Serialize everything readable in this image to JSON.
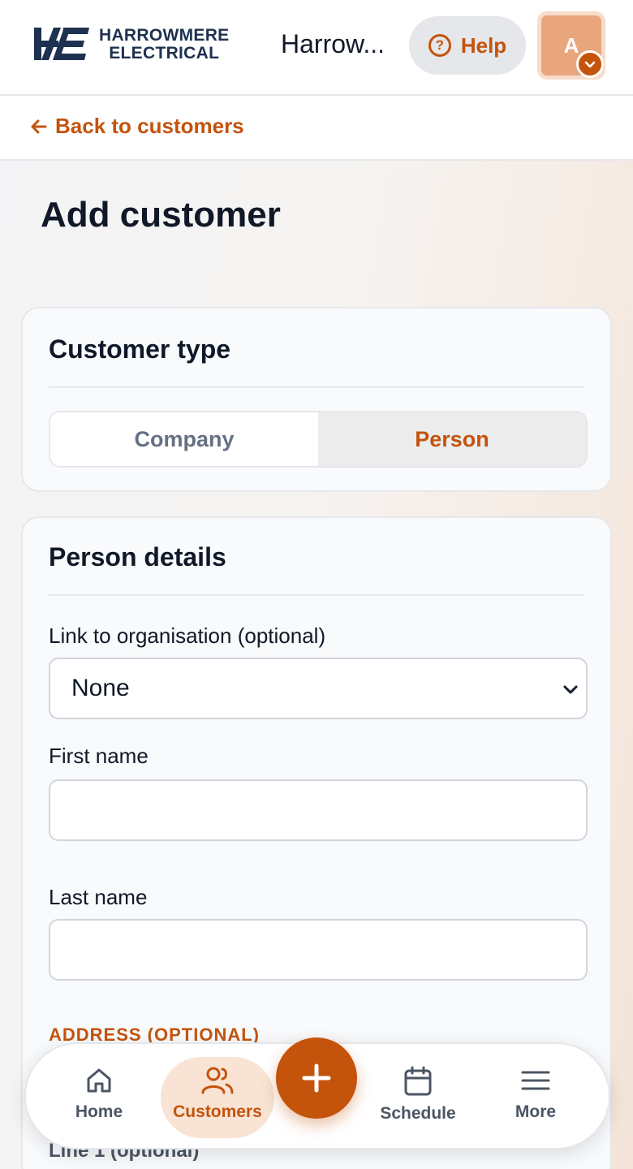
{
  "header": {
    "logo": {
      "line1": "HARROWMERE",
      "line2": "ELECTRICAL"
    },
    "org_name": "Harrow...",
    "help_label": "Help",
    "avatar_initial": "A"
  },
  "back_link": "Back to customers",
  "page_title": "Add customer",
  "customer_type": {
    "title": "Customer type",
    "options": [
      "Company",
      "Person"
    ],
    "selected": "Person"
  },
  "person_details": {
    "title": "Person details",
    "org_label": "Link to organisation (optional)",
    "org_value": "None",
    "first_name_label": "First name",
    "first_name_value": "",
    "last_name_label": "Last name",
    "last_name_value": "",
    "address_heading": "ADDRESS (OPTIONAL)",
    "line1_label": "Line 1 (optional)"
  },
  "bottom_nav": {
    "items": [
      {
        "label": "Home",
        "icon": "home-icon"
      },
      {
        "label": "Customers",
        "icon": "users-icon",
        "active": true
      },
      {
        "label": "Schedule",
        "icon": "calendar-icon"
      },
      {
        "label": "More",
        "icon": "menu-icon"
      }
    ],
    "fab_icon": "plus-icon"
  },
  "colors": {
    "accent": "#c4530c",
    "brand_navy": "#1e3150",
    "active_tab_bg": "#f8e3d4"
  }
}
